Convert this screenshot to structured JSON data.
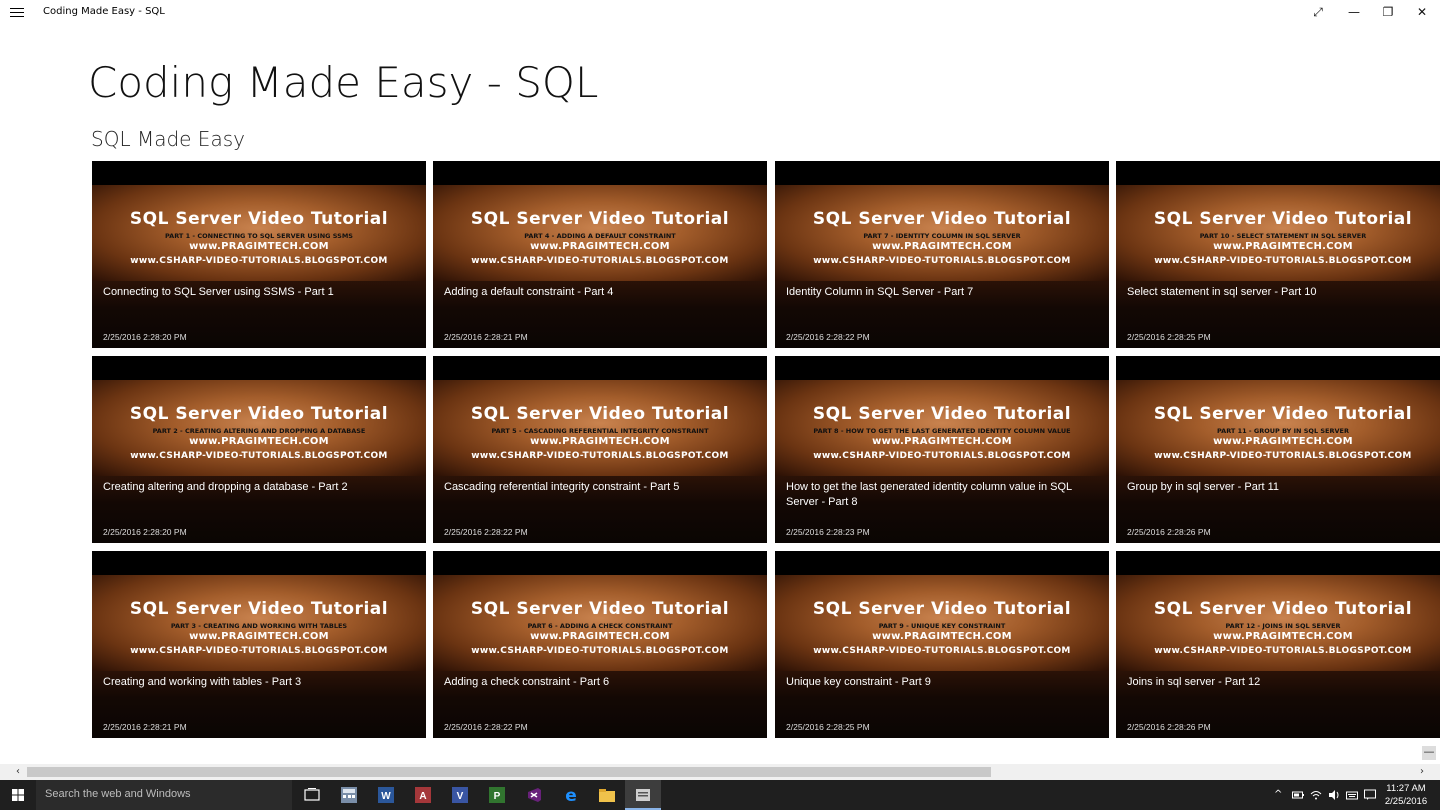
{
  "window": {
    "title": "Coding Made Easy - SQL",
    "controls": {
      "fullscreen": "⤢",
      "minimize": "—",
      "restore": "❐",
      "close": "✕"
    }
  },
  "app": {
    "title": "Coding Made Easy - SQL",
    "section": "SQL Made Easy"
  },
  "thumbnail": {
    "heading": "SQL Server Video Tutorial",
    "site1": "www.PRAGIMTECH.COM",
    "site2": "www.CSHARP-VIDEO-TUTORIALS.BLOGSPOT.COM"
  },
  "videos": [
    {
      "title": "Connecting to SQL Server using SSMS - Part 1",
      "subtitle": "Part 1 - Connecting to SQL Server using SSMS",
      "date": "2/25/2016 2:28:20 PM"
    },
    {
      "title": "Adding a default constraint - Part 4",
      "subtitle": "Part 4 - Adding a default constraint",
      "date": "2/25/2016 2:28:21 PM"
    },
    {
      "title": "Identity Column in SQL Server - Part 7",
      "subtitle": "Part 7 - Identity Column in SQL Server",
      "date": "2/25/2016 2:28:22 PM"
    },
    {
      "title": "Select statement in sql server - Part 10",
      "subtitle": "Part 10 - Select statement in sql server",
      "date": "2/25/2016 2:28:25 PM"
    },
    {
      "title": "Creating altering and dropping a database - Part 2",
      "subtitle": "Part 2 - Creating altering and dropping a database",
      "date": "2/25/2016 2:28:20 PM"
    },
    {
      "title": "Cascading referential integrity constraint - Part 5",
      "subtitle": "Part 5 - Cascading referential integrity constraint",
      "date": "2/25/2016 2:28:22 PM"
    },
    {
      "title": "How to get the last generated identity column value in SQL Server - Part 8",
      "subtitle": "Part 8 - How to get the last generated identity column value",
      "date": "2/25/2016 2:28:23 PM"
    },
    {
      "title": "Group by in sql server - Part 11",
      "subtitle": "Part 11 - Group by in sql server",
      "date": "2/25/2016 2:28:26 PM"
    },
    {
      "title": "Creating and working with tables - Part 3",
      "subtitle": "Part 3 - Creating and working with tables",
      "date": "2/25/2016 2:28:21 PM"
    },
    {
      "title": "Adding a check constraint - Part 6",
      "subtitle": "Part 6 - Adding a check constraint",
      "date": "2/25/2016 2:28:22 PM"
    },
    {
      "title": "Unique key constraint - Part 9",
      "subtitle": "Part 9 - Unique key constraint",
      "date": "2/25/2016 2:28:25 PM"
    },
    {
      "title": "Joins in sql server - Part 12",
      "subtitle": "Part 12 - Joins in sql server",
      "date": "2/25/2016 2:28:26 PM"
    }
  ],
  "scrollbar": {
    "left": "‹",
    "right": "›",
    "collapse": "—"
  },
  "taskbar": {
    "search_placeholder": "Search the web and Windows",
    "apps": [
      "task-view-icon",
      "calculator-icon",
      "word-icon",
      "access-icon",
      "visio-icon",
      "project-icon",
      "visual-studio-icon",
      "edge-icon",
      "file-explorer-icon",
      "sql-app-icon"
    ],
    "clock_time": "11:27 AM",
    "clock_date": "2/25/2016",
    "tray": {
      "chevron": "^"
    }
  },
  "colors": {
    "taskbar": "#1f1f1f",
    "search": "#2b2b2b",
    "tile_bg": "#000000",
    "thumb_gradient_center": "#c9834f"
  }
}
